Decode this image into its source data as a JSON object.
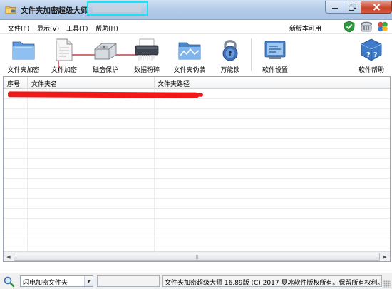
{
  "window": {
    "title": "文件夹加密超级大师"
  },
  "menu": {
    "items": [
      "文件(F)",
      "显示(V)",
      "工具(T)",
      "帮助(H)"
    ],
    "new_version": "新版本可用"
  },
  "toolbar": {
    "folder_encrypt": "文件夹加密",
    "file_encrypt": "文件加密",
    "disk_protect": "磁盘保护",
    "data_shred": "数据粉碎",
    "folder_disguise": "文件夹伪装",
    "master_lock": "万能锁",
    "settings": "软件设置",
    "help": "软件帮助"
  },
  "list": {
    "columns": [
      "序号",
      "文件夹名",
      "文件夹路径"
    ]
  },
  "status": {
    "dropdown_value": "闪电加密文件夹",
    "copyright": "文件夹加密超级大师 16.89版 (C) 2017  夏冰软件版权所有。保留所有权利。"
  },
  "colors": {
    "highlight_box": "#18e4f0",
    "redaction": "#f01818",
    "close_button": "#c8442b"
  }
}
